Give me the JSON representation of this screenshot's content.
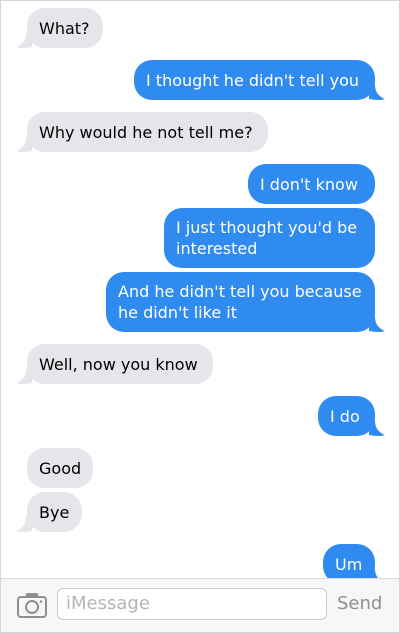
{
  "messages": [
    {
      "from": "them",
      "text": "What?"
    },
    {
      "from": "me",
      "text": "I thought he didn't tell you"
    },
    {
      "from": "them",
      "text": "Why would he not tell me?"
    },
    {
      "from": "me",
      "text": "I don't know"
    },
    {
      "from": "me",
      "text": "I just thought you'd be interested"
    },
    {
      "from": "me",
      "text": "And he didn't tell you because he didn't like it"
    },
    {
      "from": "them",
      "text": "Well, now you know"
    },
    {
      "from": "me",
      "text": "I do"
    },
    {
      "from": "them",
      "text": "Good"
    },
    {
      "from": "them",
      "text": "Bye"
    },
    {
      "from": "me",
      "text": "Um"
    }
  ],
  "composer": {
    "placeholder": "iMessage",
    "send_label": "Send",
    "camera_icon": "camera-icon"
  },
  "colors": {
    "outgoing": "#2f8bf0",
    "incoming": "#e5e5ea"
  }
}
